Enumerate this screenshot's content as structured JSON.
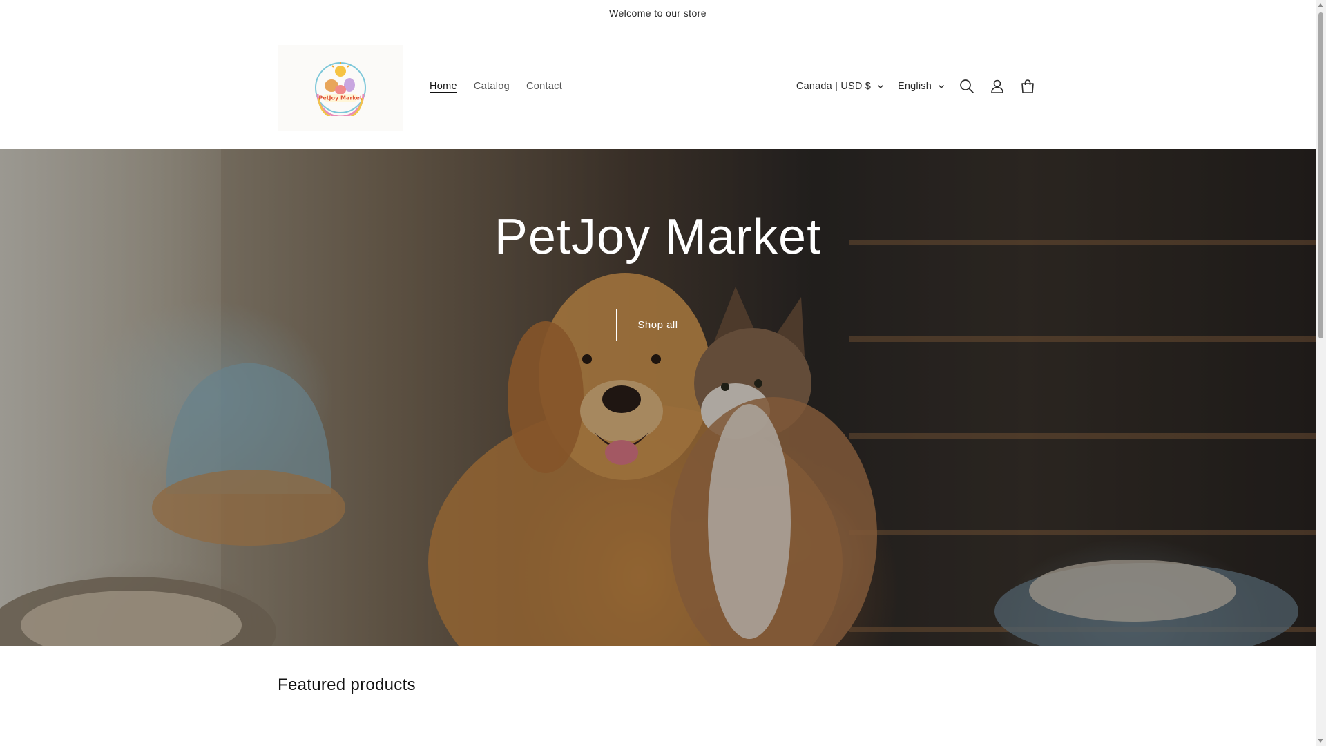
{
  "announcement": {
    "text": "Welcome to our store"
  },
  "header": {
    "logo_text": "PetJoy Market",
    "nav": [
      {
        "label": "Home",
        "active": true
      },
      {
        "label": "Catalog",
        "active": false
      },
      {
        "label": "Contact",
        "active": false
      }
    ],
    "country_selector": "Canada | USD $",
    "language_selector": "English",
    "icons": [
      "search-icon",
      "account-icon",
      "cart-icon"
    ]
  },
  "hero": {
    "title": "PetJoy Market",
    "button_label": "Shop all"
  },
  "featured": {
    "title": "Featured products"
  },
  "colors": {
    "text": "#121212",
    "muted_text": "#555555",
    "hero_text": "#ffffff",
    "border": "#e6e6e6"
  }
}
